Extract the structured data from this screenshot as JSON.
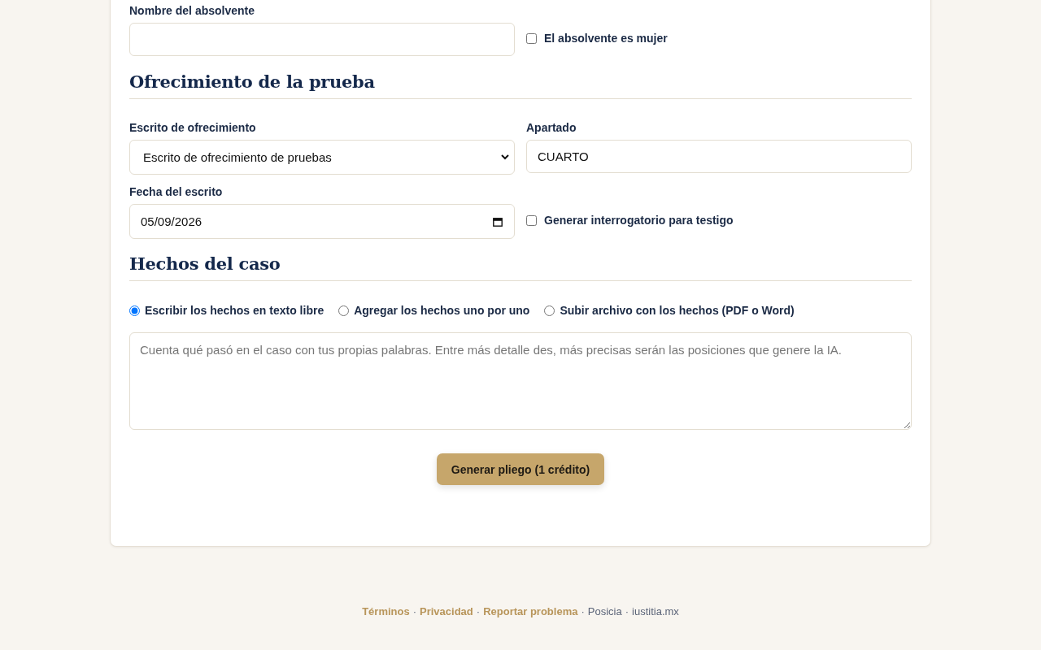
{
  "absolvente": {
    "label": "Nombre del absolvente",
    "checkbox": {
      "label": "El absolvente es mujer",
      "checked": false
    }
  },
  "ofrecimiento": {
    "heading": "Ofrecimiento de la prueba",
    "escrito": {
      "label": "Escrito de ofrecimiento",
      "value": "Escrito de ofrecimiento de pruebas"
    },
    "apartado": {
      "label": "Apartado",
      "value": "CUARTO"
    },
    "fecha": {
      "label": "Fecha del escrito",
      "value": "05/09/2026"
    },
    "checkbox": {
      "label": "Generar interrogatorio para testigo",
      "checked": false
    }
  },
  "hechos": {
    "heading": "Hechos del caso",
    "options": [
      {
        "label": "Escribir los hechos en texto libre",
        "selected": true
      },
      {
        "label": "Agregar los hechos uno por uno",
        "selected": false
      },
      {
        "label": "Subir archivo con los hechos (PDF o Word)",
        "selected": false
      }
    ],
    "placeholder": "Cuenta qué pasó en el caso con tus propias palabras. Entre más detalle des, más precisas serán las posiciones que genere la IA."
  },
  "submit": "Generar pliego (1 crédito)",
  "footer": {
    "separator": "·",
    "items": [
      {
        "text": "Términos",
        "kind": "link"
      },
      {
        "text": "Privacidad",
        "kind": "link"
      },
      {
        "text": "Reportar problema",
        "kind": "link"
      },
      {
        "text": "Posicia",
        "kind": "text"
      },
      {
        "text": "iustitia.mx",
        "kind": "text"
      }
    ]
  }
}
